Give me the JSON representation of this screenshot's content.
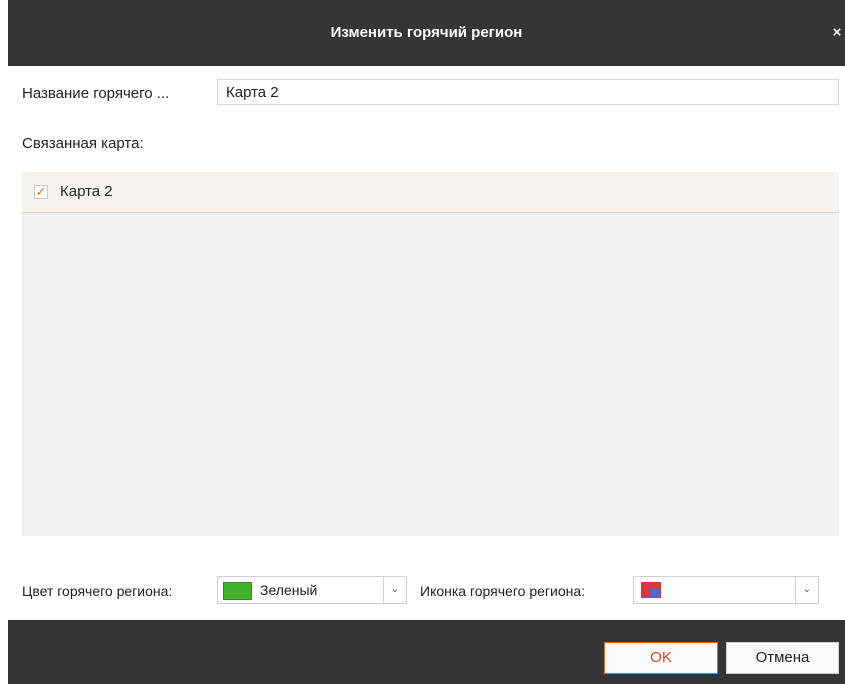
{
  "dialog": {
    "title": "Изменить горячий регион",
    "close_glyph": "×"
  },
  "form": {
    "name_label": "Название горячего ...",
    "name_value": "Карта 2",
    "linked_map_label": "Связанная карта:",
    "maps": [
      {
        "label": "Карта 2",
        "checked": true,
        "check_glyph": "✓"
      }
    ],
    "color_label": "Цвет горячего региона:",
    "color_value": "Зеленый",
    "color_swatch": "#41b22a",
    "icon_label": "Иконка горячего региона:",
    "icon_name": "hot-region-icon",
    "dropdown_glyph": "⌄"
  },
  "footer": {
    "ok_label": "OK",
    "cancel_label": "Отмена"
  },
  "colors": {
    "titlebar": "#333537",
    "accent": "#e26a25",
    "list_bg": "#f0f0f0",
    "selected_row_bg": "#f7f4ef"
  }
}
